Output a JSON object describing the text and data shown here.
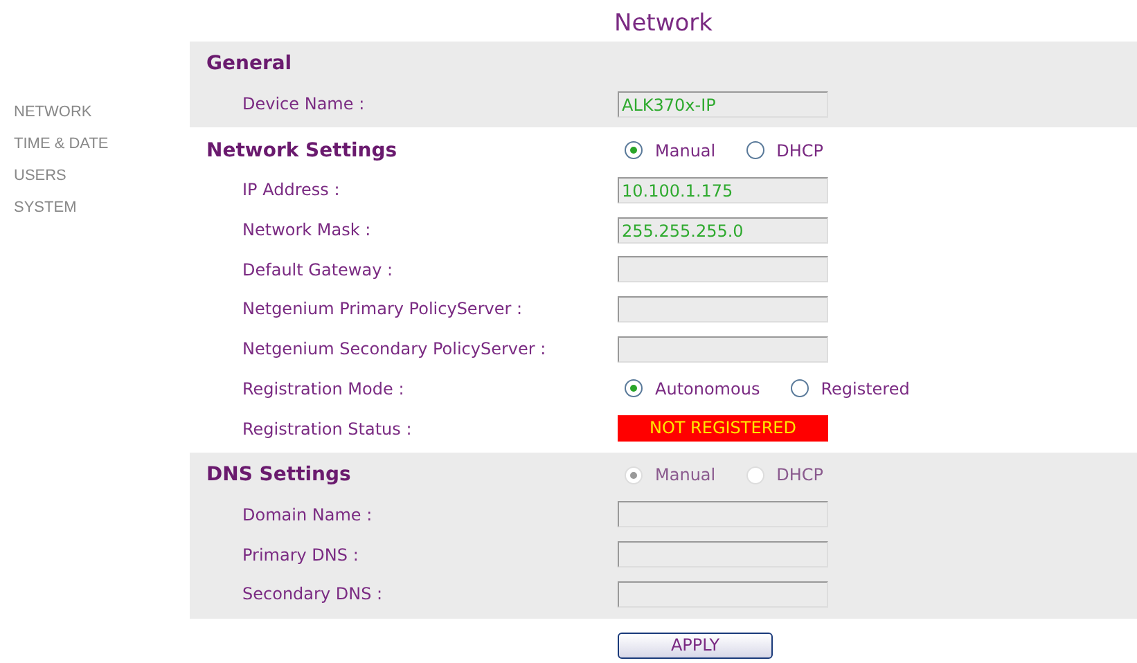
{
  "nav": [
    {
      "label": "NETWORK"
    },
    {
      "label": "TIME & DATE"
    },
    {
      "label": "USERS"
    },
    {
      "label": "SYSTEM"
    }
  ],
  "title": "Network",
  "sections": [
    {
      "title": "General",
      "shaded": true,
      "rows": [
        {
          "kind": "field",
          "label": "Device Name :",
          "value": "ALK370x-IP"
        }
      ]
    },
    {
      "title": "Network Settings",
      "shaded": false,
      "options": [
        {
          "label": "Manual",
          "selected": true,
          "disabled": false
        },
        {
          "label": "DHCP",
          "selected": false,
          "disabled": false
        }
      ],
      "rows": [
        {
          "kind": "field",
          "label": "IP Address :",
          "value": "10.100.1.175"
        },
        {
          "kind": "field",
          "label": "Network Mask :",
          "value": "255.255.255.0"
        },
        {
          "kind": "field",
          "label": "Default Gateway :"
        },
        {
          "kind": "field",
          "label": "Netgenium Primary PolicyServer :"
        },
        {
          "kind": "field",
          "label": "Netgenium Secondary PolicyServer :"
        },
        {
          "kind": "radio",
          "label": "Registration Mode :",
          "options": [
            {
              "label": "Autonomous",
              "selected": true,
              "disabled": false
            },
            {
              "label": "Registered",
              "selected": false,
              "disabled": false
            }
          ]
        },
        {
          "kind": "status",
          "label": "Registration Status :",
          "value": "NOT REGISTERED"
        }
      ]
    },
    {
      "title": "DNS Settings",
      "shaded": true,
      "options": [
        {
          "label": "Manual",
          "selected": true,
          "disabled": true
        },
        {
          "label": "DHCP",
          "selected": false,
          "disabled": true
        }
      ],
      "rows": [
        {
          "kind": "field",
          "label": "Domain Name :"
        },
        {
          "kind": "field",
          "label": "Primary DNS :"
        },
        {
          "kind": "field",
          "label": "Secondary DNS :"
        }
      ]
    }
  ],
  "apply": "APPLY"
}
